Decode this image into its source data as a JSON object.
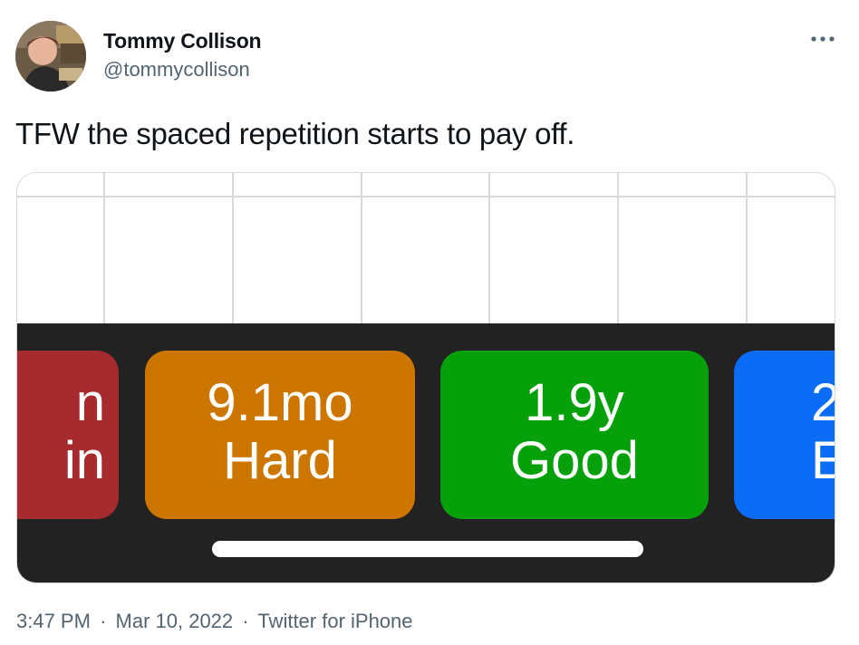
{
  "author": {
    "name": "Tommy Collison",
    "handle": "@tommycollison"
  },
  "tweet": {
    "text": "TFW the spaced repetition starts to pay off."
  },
  "media": {
    "buttons": [
      {
        "interval": "n",
        "label": "in",
        "color": "#a52b2f"
      },
      {
        "interval": "9.1mo",
        "label": "Hard",
        "color": "#cc7600"
      },
      {
        "interval": "1.9y",
        "label": "Good",
        "color": "#06a10a"
      },
      {
        "interval": "2",
        "label": "E",
        "color": "#0b6cf5"
      }
    ]
  },
  "meta": {
    "time": "3:47 PM",
    "separator": "·",
    "date": "Mar 10, 2022",
    "source": "Twitter for iPhone"
  },
  "icons": {
    "more": "more-horizontal-icon"
  }
}
